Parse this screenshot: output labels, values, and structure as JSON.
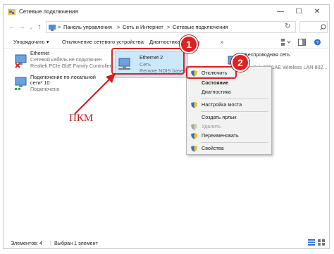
{
  "window": {
    "title": "Сетевые подключения",
    "controls": {
      "minimize": "—",
      "maximize": "☐",
      "close": "✕"
    }
  },
  "address": {
    "back": "←",
    "forward": "→",
    "dropdown": "⌄",
    "up": "↑",
    "crumbs": [
      "Панель управления",
      "Сеть и Интернет",
      "Сетевые подключения"
    ],
    "separator": ">",
    "refresh": "↻"
  },
  "toolbar": {
    "organize": "Упорядочить ▾",
    "disable_device": "Отключение сетевого устройства",
    "diagnostics": "Диагностика подклю",
    "more": "»"
  },
  "items": [
    {
      "name": "Ethernet",
      "status": "Сетевой кабель не подключен",
      "device": "Realtek PCIe GbE Family Controller"
    },
    {
      "name": "Ethernet 2",
      "status": "Сеть",
      "device": "Remote NDIS based"
    },
    {
      "name": "Беспроводная сеть",
      "status": "",
      "device": "Realtek 8821AE Wireless LAN 802..."
    },
    {
      "name": "Подключение по локальной сети* 10",
      "name_line1": "Подключение по локальной",
      "name_line2": "сети* 10",
      "status": "Подключено"
    }
  ],
  "context_menu": {
    "disable": "Отключить",
    "status": "Состояние",
    "diagnostics": "Диагностика",
    "bridge": "Настройка моста",
    "shortcut": "Создать ярлык",
    "delete": "Удалить",
    "rename": "Переименовать",
    "properties": "Свойства"
  },
  "annotation": {
    "step1": "1",
    "step2": "2",
    "pkm_label": "ПКМ"
  },
  "statusbar": {
    "elements": "Элементов: 4",
    "selected": "Выбран 1 элемент"
  },
  "colors": {
    "accent_red": "#e12020",
    "selection": "#cce8ff",
    "menu_bg": "#f2f2f2"
  }
}
